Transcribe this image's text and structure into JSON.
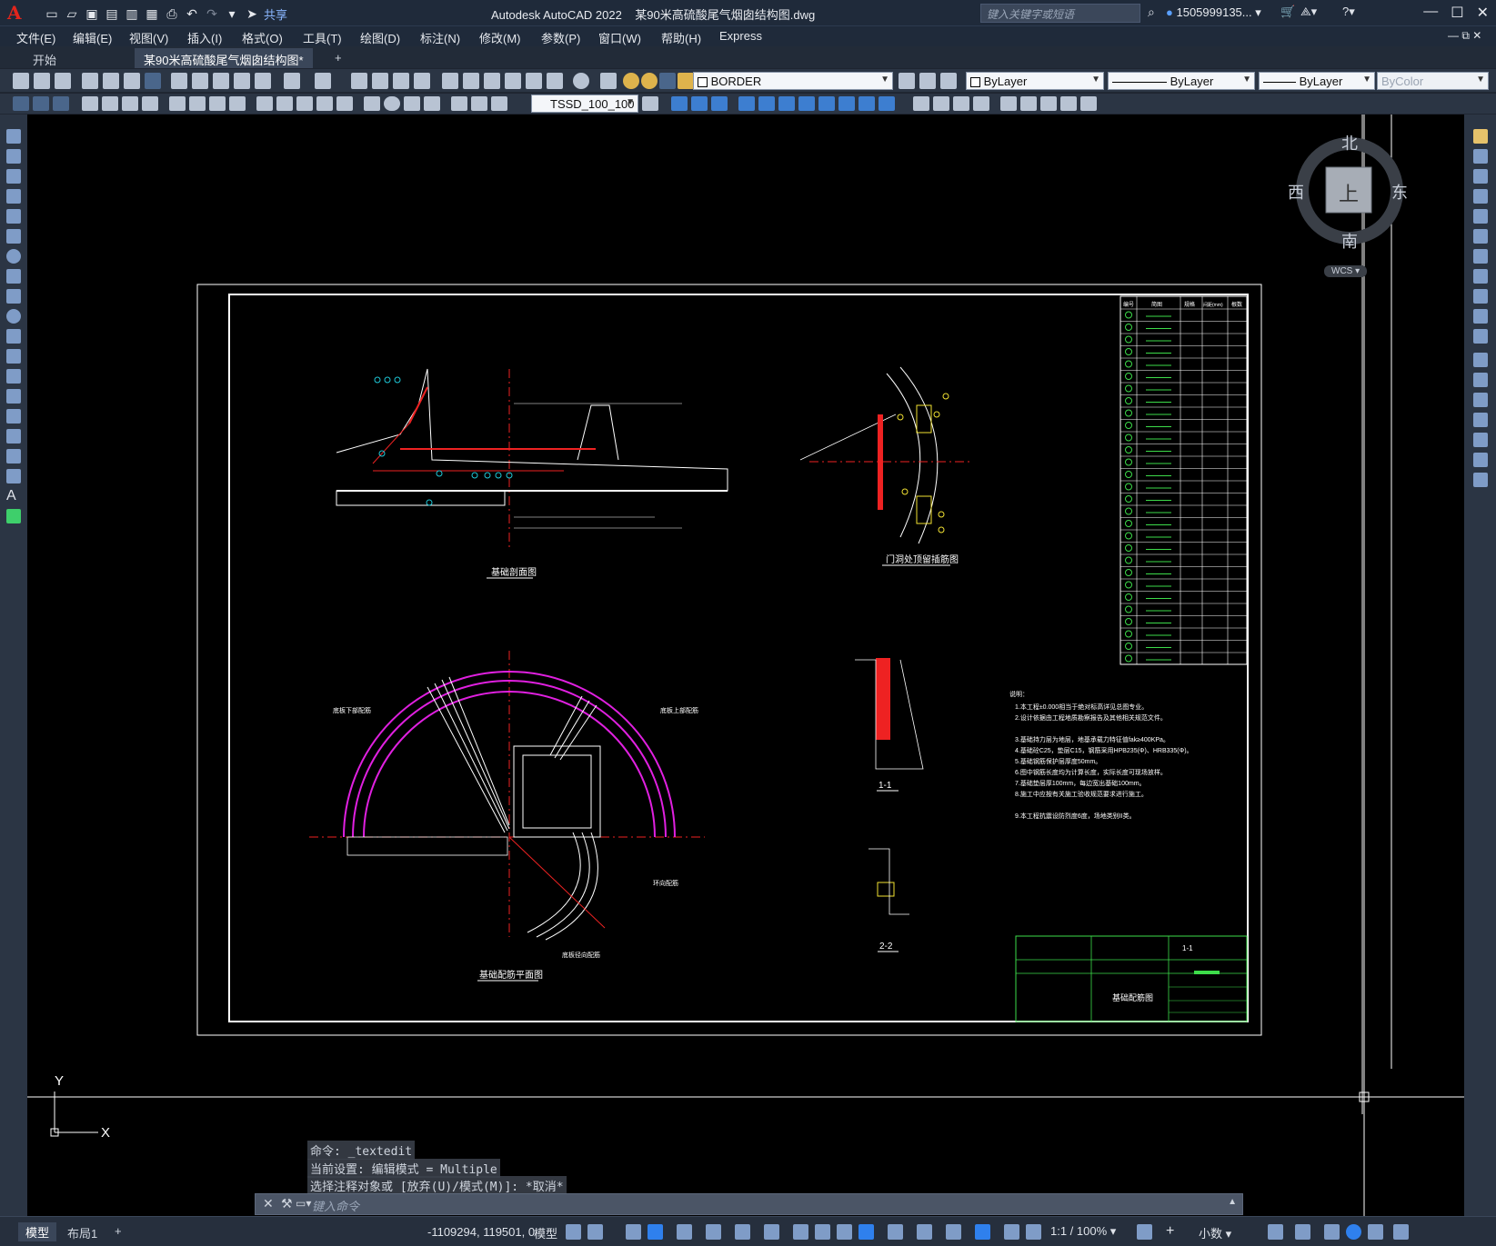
{
  "window": {
    "app_title": "Autodesk AutoCAD 2022",
    "doc_title": "某90米高硫酸尾气烟囱结构图.dwg",
    "share_label": "共享",
    "search_placeholder": "键入关键字或短语",
    "user": "1505999135..."
  },
  "menu": [
    "文件(E)",
    "编辑(E)",
    "视图(V)",
    "插入(I)",
    "格式(O)",
    "工具(T)",
    "绘图(D)",
    "标注(N)",
    "修改(M)",
    "参数(P)",
    "窗口(W)",
    "帮助(H)",
    "Express"
  ],
  "tabs": {
    "start": "开始",
    "doc": "某90米高硫酸尾气烟囱结构图*",
    "add": "+"
  },
  "toolbar": {
    "layer": "BORDER",
    "color": "ByLayer",
    "linetype": "ByLayer",
    "lineweight": "ByLayer",
    "plotstyle": "ByColor",
    "dimstyle": "TSSD_100_100"
  },
  "viewcube": {
    "north": "北",
    "south": "南",
    "east": "东",
    "west": "西",
    "top": "上",
    "wcs": "WCS"
  },
  "drawing": {
    "view1": "基础剖面图",
    "view2": "门洞处顶留插筋图",
    "view3": "基础配筋平面图",
    "sec11": "1-1",
    "sec22": "2-2",
    "notes_title": "说明：",
    "notes": [
      "1.本工程±0.000相当于绝对标高详见总图专业。",
      "2.设计依据由工程地质勘察报告及其他相关规范文件。",
      "3.基础持力层为地层，地基承载力特征值fak≥400KPa。",
      "4.基础砼C25，垫层C15，钢筋采用HPB235(Φ)、HRB335(Φ)。",
      "5.基础钢筋保护层厚度50mm。",
      "6.图中钢筋长度均为计算长度，实际长度可现场放样。",
      "7.基础垫层厚100mm，每边宽出基础100mm。",
      "8.施工中应按有关施工验收规范要求进行施工。",
      "9.本工程抗震设防烈度6度，场地类别II类。"
    ],
    "titleblock_name": "基础配筋图",
    "titleblock_no": "1-1",
    "label_ringtop": "底板上部配筋",
    "label_ringbot": "底板下部配筋",
    "label_radial": "环向配筋",
    "label_rad2": "底板径向配筋",
    "table_headers": [
      "编号",
      "简图",
      "规格",
      "间距(mm)",
      "根数"
    ]
  },
  "command": {
    "hist1": "命令: _textedit",
    "hist2": "当前设置: 编辑模式 = Multiple",
    "hist3": "选择注释对象或 [放弃(U)/模式(M)]: *取消*",
    "prompt": "键入命令"
  },
  "status": {
    "model_tab": "模型",
    "layout_tab": "布局1",
    "add_tab": "+",
    "coords": "-1109294, 119501, 0",
    "model_label": "模型",
    "scale": "1:1 / 100%",
    "units": "小数"
  },
  "ucs": {
    "x": "X",
    "y": "Y"
  }
}
